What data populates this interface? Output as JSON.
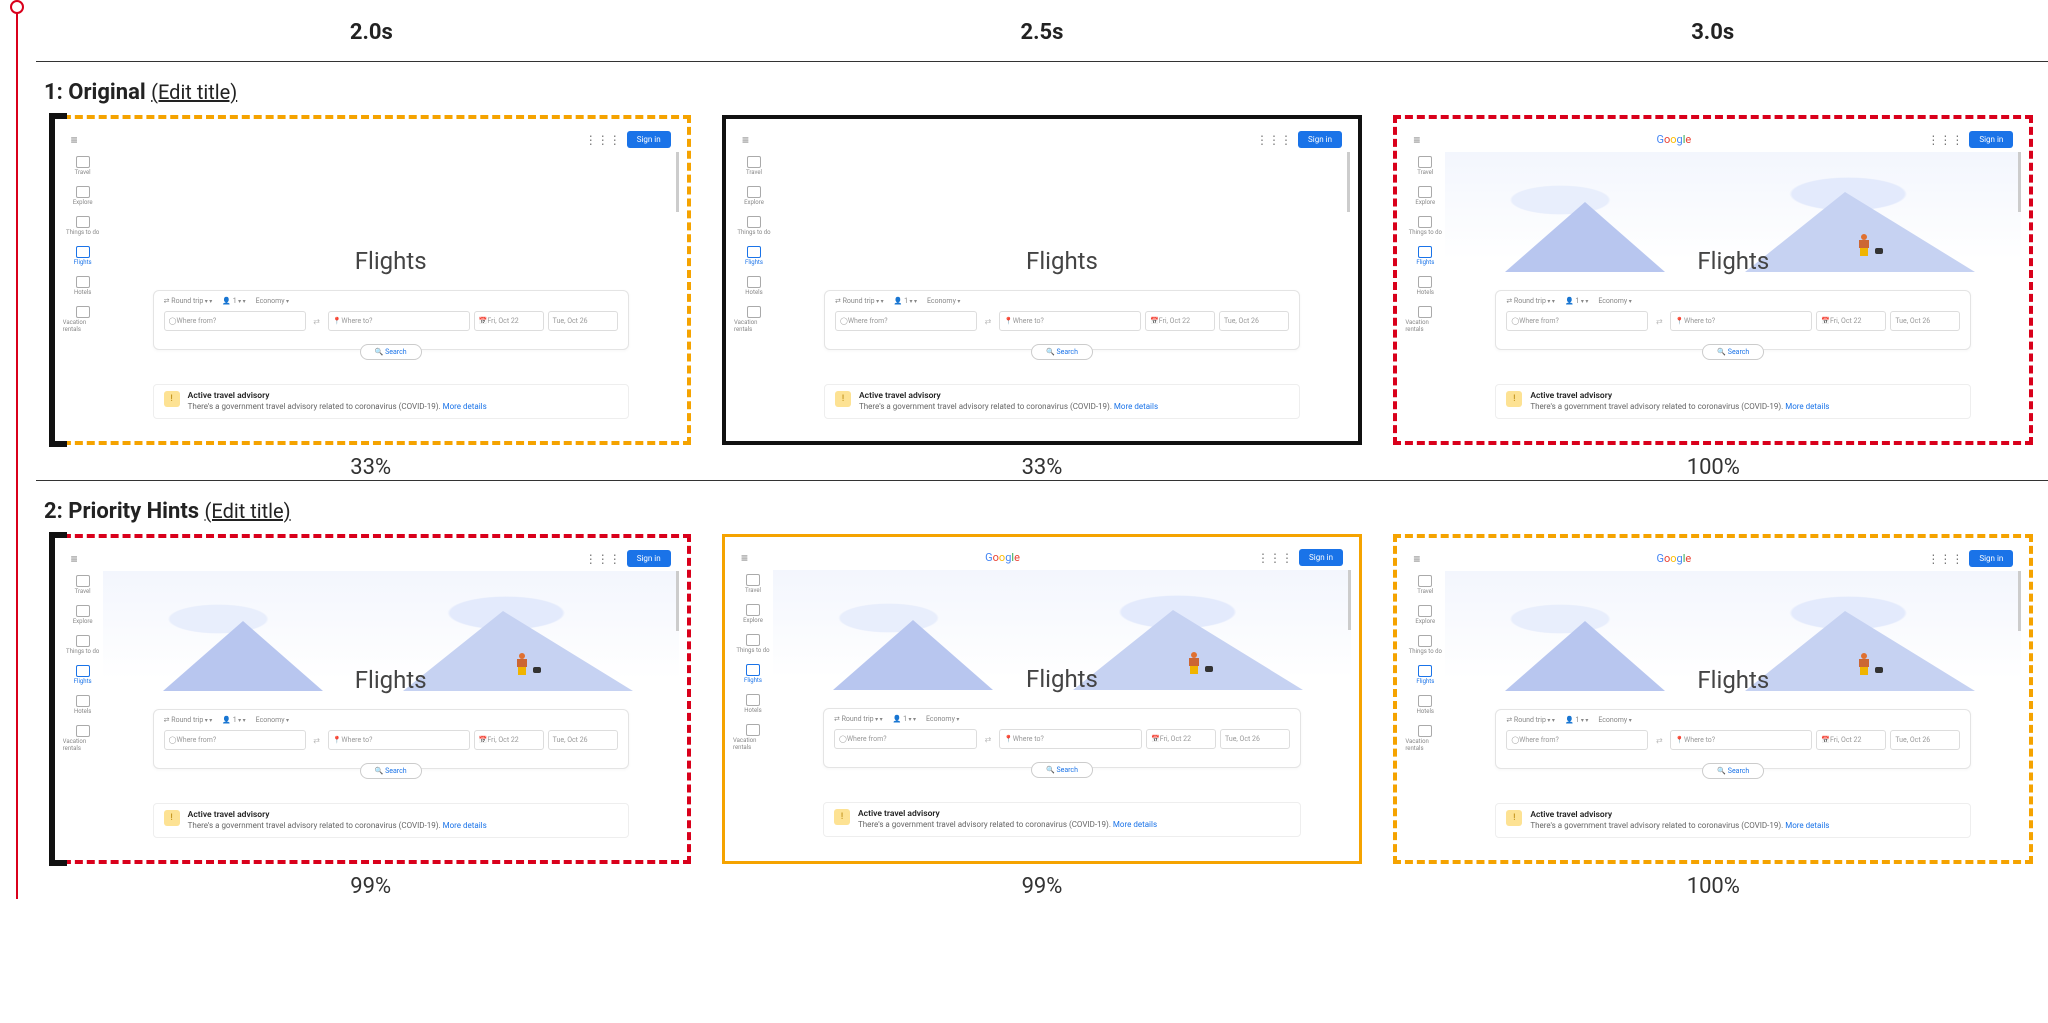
{
  "time_header": {
    "t1": "2.0s",
    "t2": "2.5s",
    "t3": "3.0s"
  },
  "edit_title_label": "(Edit title)",
  "variants": [
    {
      "label_prefix": "1: ",
      "name": "Original",
      "frames": [
        {
          "pct": "33%",
          "border": "dashed-orange",
          "left_black": true,
          "hero_loaded": false,
          "logo_loaded": false
        },
        {
          "pct": "33%",
          "border": "solid-black",
          "left_black": false,
          "hero_loaded": false,
          "logo_loaded": false
        },
        {
          "pct": "100%",
          "border": "dashed-red",
          "left_black": false,
          "hero_loaded": true,
          "logo_loaded": true
        }
      ]
    },
    {
      "label_prefix": "2: ",
      "name": "Priority Hints",
      "frames": [
        {
          "pct": "99%",
          "border": "dashed-red",
          "left_black": true,
          "hero_loaded": true,
          "logo_loaded": false
        },
        {
          "pct": "99%",
          "border": "solid-orange",
          "left_black": false,
          "hero_loaded": true,
          "logo_loaded": true
        },
        {
          "pct": "100%",
          "border": "dashed-orange",
          "left_black": false,
          "hero_loaded": true,
          "logo_loaded": true
        }
      ]
    }
  ],
  "shot": {
    "logo_text": "Google",
    "sign_in": "Sign in",
    "sidebar": [
      "Travel",
      "Explore",
      "Things to do",
      "Flights",
      "Hotels",
      "Vacation rentals"
    ],
    "page_title": "Flights",
    "opts": {
      "trip": "Round trip",
      "pax": "1",
      "cabin": "Economy"
    },
    "fields": {
      "from_placeholder": "Where from?",
      "to_placeholder": "Where to?",
      "date1": "Fri, Oct 22",
      "date2": "Tue, Oct 26"
    },
    "search_label": "Search",
    "advisory": {
      "heading": "Active travel advisory",
      "body": "There's a government travel advisory related to coronavirus (COVID-19).",
      "link": "More details"
    }
  }
}
